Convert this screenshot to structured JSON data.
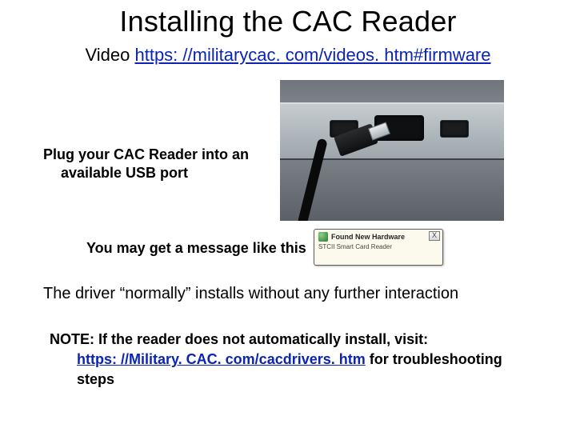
{
  "title": "Installing the CAC Reader",
  "video": {
    "label": "Video ",
    "link_text": "https: //militarycac. com/videos. htm#firmware"
  },
  "plug": {
    "line1": "Plug your CAC Reader into an",
    "line2": "available USB port"
  },
  "message_line": "You may get a message like this",
  "bubble": {
    "title": "Found New Hardware",
    "sub": "STCII Smart Card Reader",
    "close": "X"
  },
  "driver_line": "The driver “normally” installs without any further interaction",
  "note": {
    "line1": "NOTE:  If the reader does not automatically install, visit:",
    "link_text": "https: //Military. CAC. com/cacdrivers. htm",
    "after_link": "  for troubleshooting",
    "line3": "steps"
  }
}
